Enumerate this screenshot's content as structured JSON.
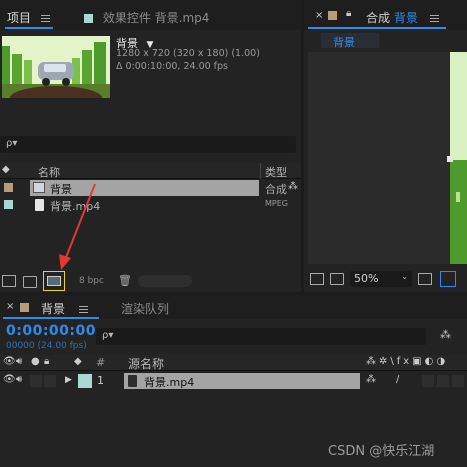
{
  "project_panel": {
    "tab_label": "项目",
    "effects_tab_label": "效果控件 背景.mp4",
    "preview": {
      "name": "背景",
      "dims": "1280 x 720  (320 x 180) (1.00)",
      "duration": "Δ 0:00:10:00, 24.00 fps"
    },
    "search_placeholder": "ρ▾",
    "columns": {
      "name": "名称",
      "type": "类型"
    },
    "items": [
      {
        "name": "背景",
        "type": "合成"
      },
      {
        "name": "背景.mp4",
        "type": "MPEG"
      }
    ],
    "bpc_label": "8 bpc"
  },
  "comp_panel": {
    "tab_prefix": "合成",
    "tab_name": "背景",
    "sub_tab": "背景",
    "zoom": "50%"
  },
  "timeline": {
    "tab_label": "背景",
    "render_queue_label": "渲染队列",
    "timecode": "0:00:00:00",
    "frame_info": "00000 (24.00 fps)",
    "header": {
      "hash": "#",
      "source_name": "源名称"
    },
    "layers": [
      {
        "index": "1",
        "name": "背景.mp4"
      }
    ]
  },
  "watermark": "CSDN @快乐江湖",
  "colors": {
    "accent_blue": "#2d8ceb",
    "highlight_yellow": "#e3d32a",
    "arrow_red": "#e23a2e",
    "selected_row": "#a4a4a4"
  }
}
